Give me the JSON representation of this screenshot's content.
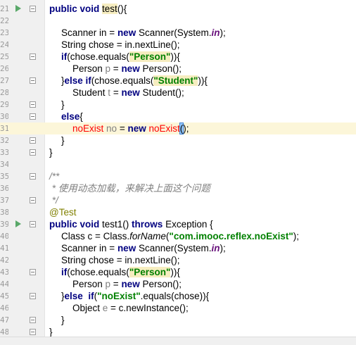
{
  "editor": {
    "lines": [
      {
        "n": "21",
        "run": true,
        "fold": true,
        "current": false,
        "indent": 1,
        "tokens": [
          {
            "t": "public",
            "c": "kw"
          },
          {
            "t": " "
          },
          {
            "t": "void",
            "c": "kw"
          },
          {
            "t": " "
          },
          {
            "t": "test",
            "c": "hl"
          },
          {
            "t": "(){"
          }
        ]
      },
      {
        "n": "22",
        "indent": 0,
        "tokens": []
      },
      {
        "n": "23",
        "indent": 2,
        "tokens": [
          {
            "t": "Scanner in = "
          },
          {
            "t": "new",
            "c": "kw"
          },
          {
            "t": " Scanner(System."
          },
          {
            "t": "in",
            "c": "staticf"
          },
          {
            "t": ");"
          }
        ]
      },
      {
        "n": "24",
        "indent": 2,
        "tokens": [
          {
            "t": "String chose = in.nextLine();"
          }
        ]
      },
      {
        "n": "25",
        "indent": 2,
        "fold": true,
        "tokens": [
          {
            "t": "if",
            "c": "kw"
          },
          {
            "t": "(chose.equals("
          },
          {
            "t": "\"Person\"",
            "c": "str hl"
          },
          {
            "t": ")){"
          }
        ]
      },
      {
        "n": "26",
        "indent": 3,
        "tokens": [
          {
            "t": "Person "
          },
          {
            "t": "p",
            "c": "unused"
          },
          {
            "t": " = "
          },
          {
            "t": "new",
            "c": "kw"
          },
          {
            "t": " Person();"
          }
        ]
      },
      {
        "n": "27",
        "indent": 2,
        "fold": true,
        "tokens": [
          {
            "t": "}"
          },
          {
            "t": "else if",
            "c": "kw"
          },
          {
            "t": "(chose.equals("
          },
          {
            "t": "\"Student\"",
            "c": "str hl"
          },
          {
            "t": ")){"
          }
        ]
      },
      {
        "n": "28",
        "indent": 3,
        "tokens": [
          {
            "t": "Student "
          },
          {
            "t": "t",
            "c": "unused"
          },
          {
            "t": " = "
          },
          {
            "t": "new",
            "c": "kw"
          },
          {
            "t": " Student();"
          }
        ]
      },
      {
        "n": "29",
        "indent": 2,
        "fold": true,
        "tokens": [
          {
            "t": "}"
          }
        ]
      },
      {
        "n": "30",
        "indent": 2,
        "fold": true,
        "tokens": [
          {
            "t": "else",
            "c": "kw"
          },
          {
            "t": "{"
          }
        ]
      },
      {
        "n": "31",
        "indent": 3,
        "current": true,
        "tokens": [
          {
            "t": "noExist",
            "c": "err"
          },
          {
            "t": " "
          },
          {
            "t": "no",
            "c": "unused"
          },
          {
            "t": " = "
          },
          {
            "t": "new",
            "c": "kw"
          },
          {
            "t": " "
          },
          {
            "t": "noExist",
            "c": "err"
          },
          {
            "t": "(",
            "c": "caret-match"
          },
          {
            "t": ");"
          }
        ]
      },
      {
        "n": "32",
        "indent": 2,
        "fold": true,
        "tokens": [
          {
            "t": "}"
          }
        ]
      },
      {
        "n": "33",
        "indent": 1,
        "fold": true,
        "tokens": [
          {
            "t": "}"
          }
        ]
      },
      {
        "n": "34",
        "indent": 0,
        "tokens": []
      },
      {
        "n": "35",
        "indent": 1,
        "fold": true,
        "tokens": [
          {
            "t": "/**",
            "c": "cmt"
          }
        ]
      },
      {
        "n": "36",
        "indent": 1,
        "tokens": [
          {
            "t": " * 使用动态加载，来解决上面这个问题",
            "c": "cmt"
          }
        ]
      },
      {
        "n": "37",
        "indent": 1,
        "fold": true,
        "tokens": [
          {
            "t": " */",
            "c": "cmt"
          }
        ]
      },
      {
        "n": "38",
        "indent": 1,
        "tokens": [
          {
            "t": "@Test",
            "c": "ann"
          }
        ]
      },
      {
        "n": "39",
        "run": true,
        "fold": true,
        "indent": 1,
        "tokens": [
          {
            "t": "public",
            "c": "kw"
          },
          {
            "t": " "
          },
          {
            "t": "void",
            "c": "kw"
          },
          {
            "t": " test1() "
          },
          {
            "t": "throws",
            "c": "kw"
          },
          {
            "t": " Exception {"
          }
        ]
      },
      {
        "n": "40",
        "indent": 2,
        "tokens": [
          {
            "t": "Class c = Class."
          },
          {
            "t": "forName",
            "c": "method-it"
          },
          {
            "t": "("
          },
          {
            "t": "\"com.imooc.reflex.noExist\"",
            "c": "str"
          },
          {
            "t": ");"
          }
        ]
      },
      {
        "n": "41",
        "indent": 2,
        "tokens": [
          {
            "t": "Scanner in = "
          },
          {
            "t": "new",
            "c": "kw"
          },
          {
            "t": " Scanner(System."
          },
          {
            "t": "in",
            "c": "staticf"
          },
          {
            "t": ");"
          }
        ]
      },
      {
        "n": "42",
        "indent": 2,
        "tokens": [
          {
            "t": "String chose = in.nextLine();"
          }
        ]
      },
      {
        "n": "43",
        "indent": 2,
        "fold": true,
        "tokens": [
          {
            "t": "if",
            "c": "kw"
          },
          {
            "t": "(chose.equals("
          },
          {
            "t": "\"Person\"",
            "c": "str hl"
          },
          {
            "t": ")){"
          }
        ]
      },
      {
        "n": "44",
        "indent": 3,
        "tokens": [
          {
            "t": "Person "
          },
          {
            "t": "p",
            "c": "unused"
          },
          {
            "t": " = "
          },
          {
            "t": "new",
            "c": "kw"
          },
          {
            "t": " Person();"
          }
        ]
      },
      {
        "n": "45",
        "indent": 2,
        "fold": true,
        "tokens": [
          {
            "t": "}"
          },
          {
            "t": "else",
            "c": "kw"
          },
          {
            "t": "  "
          },
          {
            "t": "if",
            "c": "kw"
          },
          {
            "t": "("
          },
          {
            "t": "\"noExist\"",
            "c": "str"
          },
          {
            "t": ".equals(chose)){"
          }
        ]
      },
      {
        "n": "46",
        "indent": 3,
        "tokens": [
          {
            "t": "Object "
          },
          {
            "t": "e",
            "c": "unused"
          },
          {
            "t": " = c.newInstance();"
          }
        ]
      },
      {
        "n": "47",
        "indent": 2,
        "fold": true,
        "tokens": [
          {
            "t": "}"
          }
        ]
      },
      {
        "n": "48",
        "indent": 1,
        "fold": true,
        "tokens": [
          {
            "t": "}"
          }
        ]
      }
    ],
    "bottom_partial": "· · · · · · · · · · ·"
  }
}
